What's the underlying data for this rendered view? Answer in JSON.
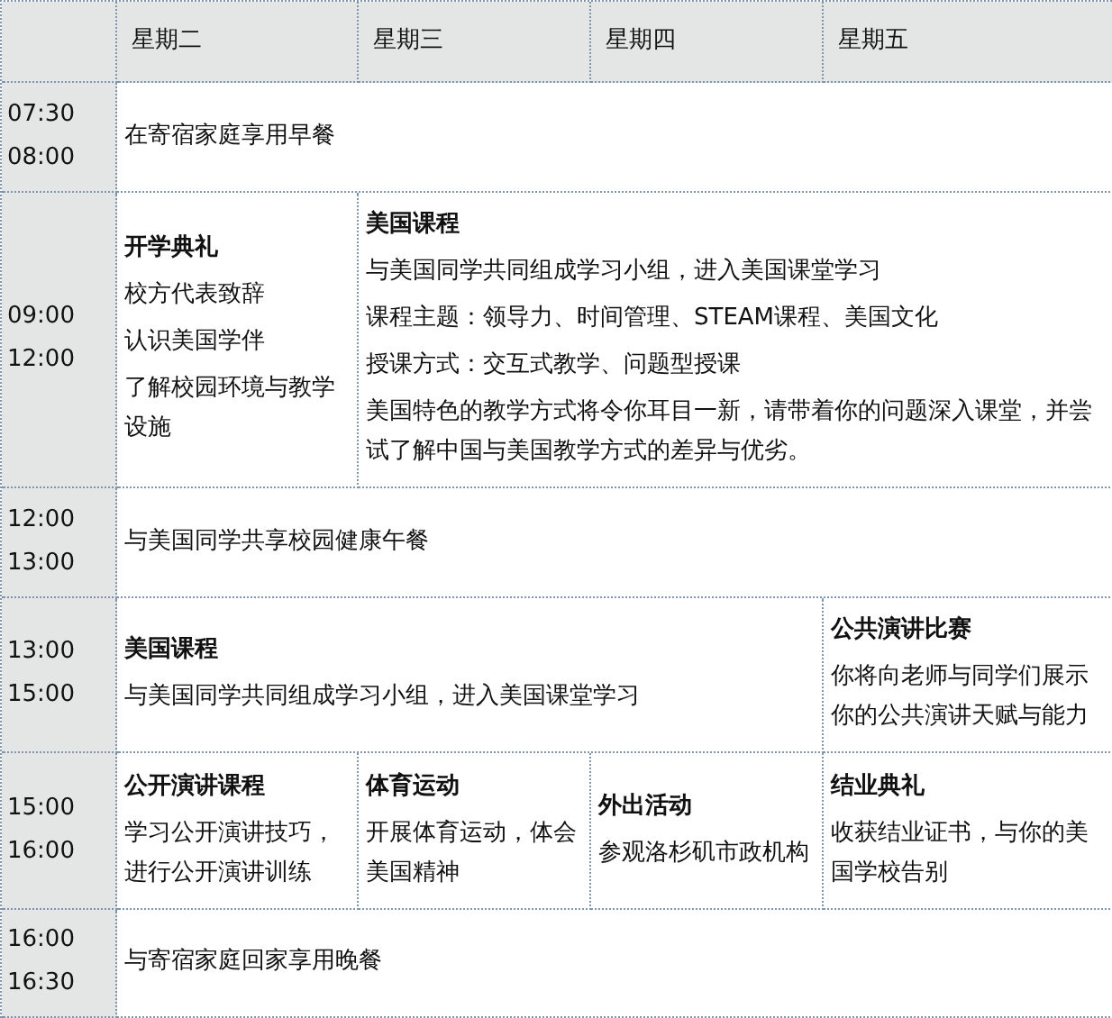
{
  "columns": [
    "星期二",
    "星期三",
    "星期四",
    "星期五"
  ],
  "rows": [
    {
      "time": [
        "07:30",
        "08:00"
      ],
      "cells": [
        {
          "kind": "meal",
          "lines": [
            "在寄宿家庭享用早餐"
          ]
        }
      ]
    },
    {
      "time": [
        "09:00",
        "12:00"
      ],
      "cells": [
        {
          "kind": "event",
          "title": "开学典礼",
          "lines": [
            "校方代表致辞",
            "认识美国学伴",
            "了解校园环境与教学设施"
          ]
        },
        {
          "kind": "course",
          "title": "美国课程",
          "lines": [
            "与美国同学共同组成学习小组，进入美国课堂学习",
            "课程主题：领导力、时间管理、STEAM课程、美国文化",
            "授课方式：交互式教学、问题型授课",
            "美国特色的教学方式将令你耳目一新，请带着你的问题深入课堂，并尝试了解中国与美国教学方式的差异与优劣。"
          ]
        }
      ]
    },
    {
      "time": [
        "12:00",
        "13:00"
      ],
      "cells": [
        {
          "kind": "meal",
          "lines": [
            "与美国同学共享校园健康午餐"
          ]
        }
      ]
    },
    {
      "time": [
        "13:00",
        "15:00"
      ],
      "cells": [
        {
          "kind": "course",
          "title": "美国课程",
          "lines": [
            "与美国同学共同组成学习小组，进入美国课堂学习"
          ]
        },
        {
          "kind": "event",
          "title": "公共演讲比赛",
          "lines": [
            "你将向老师与同学们展示你的公共演讲天赋与能力"
          ]
        }
      ]
    },
    {
      "time": [
        "15:00",
        "16:00"
      ],
      "cells": [
        {
          "kind": "event",
          "title": "公开演讲课程",
          "lines": [
            "学习公开演讲技巧，进行公开演讲训练"
          ]
        },
        {
          "kind": "event",
          "title": "体育运动",
          "lines": [
            "开展体育运动，体会美国精神"
          ]
        },
        {
          "kind": "event",
          "title": "外出活动",
          "lines": [
            "参观洛杉矶市政机构"
          ]
        },
        {
          "kind": "event",
          "title": "结业典礼",
          "lines": [
            "收获结业证书，与你的美国学校告别"
          ]
        }
      ]
    },
    {
      "time": [
        "16:00",
        "16:30"
      ],
      "cells": [
        {
          "kind": "meal",
          "lines": [
            "与寄宿家庭回家享用晚餐"
          ]
        }
      ]
    }
  ]
}
